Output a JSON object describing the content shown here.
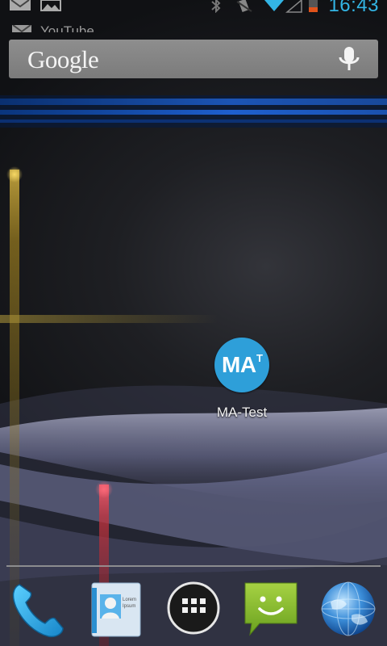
{
  "status_bar": {
    "time": "16:43",
    "left_icons": [
      "gmail-icon",
      "gallery-icon"
    ],
    "right_icons": [
      "bluetooth-icon",
      "vibrate-icon",
      "wifi-icon",
      "signal-icon",
      "battery-icon"
    ]
  },
  "notification_ticker": {
    "text": "YouTube"
  },
  "search_bar": {
    "logo": "Google",
    "voice_icon": "mic-icon"
  },
  "home_apps": [
    {
      "label": "MA-Test",
      "icon_text": "MA",
      "icon_superscript": "T",
      "icon_color": "#2e9fd9"
    }
  ],
  "dock": [
    {
      "name": "phone",
      "icon": "phone-icon"
    },
    {
      "name": "contacts",
      "icon": "contacts-icon",
      "icon_text": [
        "Lorem",
        "Ipsum"
      ]
    },
    {
      "name": "all-apps",
      "icon": "app-drawer-icon"
    },
    {
      "name": "messaging",
      "icon": "messaging-icon"
    },
    {
      "name": "browser",
      "icon": "globe-icon"
    }
  ],
  "colors": {
    "accent_blue": "#33b5e5",
    "wallpaper_dark": "#1e1f23",
    "wallpaper_light": "#a8abcf"
  }
}
